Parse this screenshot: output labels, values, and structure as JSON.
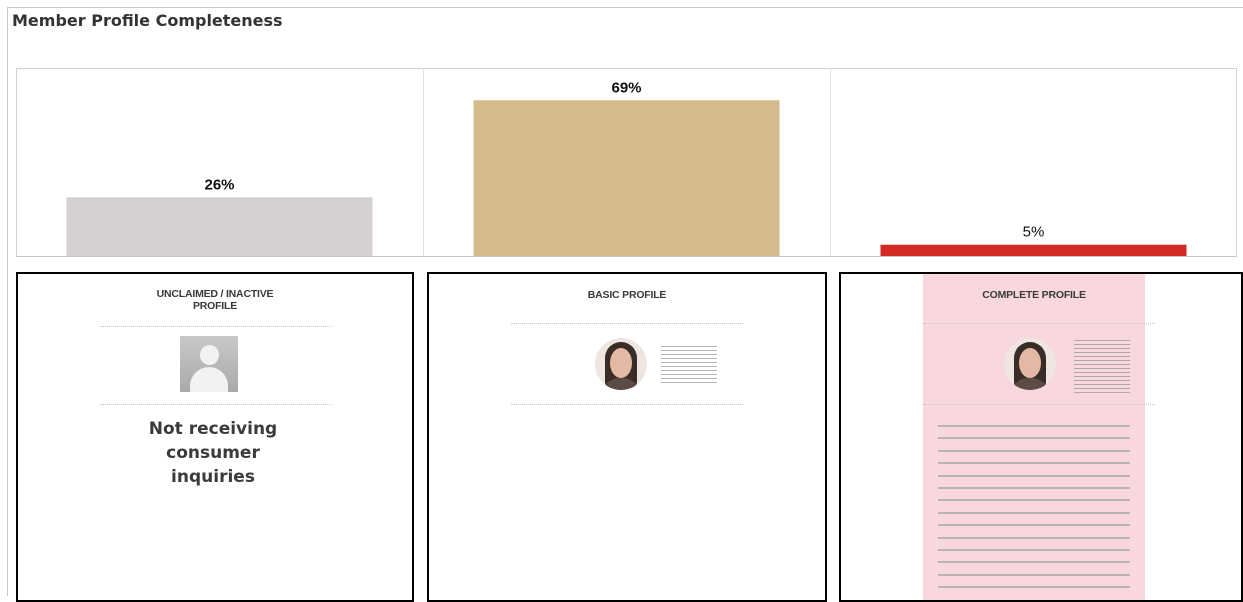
{
  "page": {
    "title": "Member Profile Completeness"
  },
  "chart_data": {
    "type": "bar",
    "categories": [
      "UNCLAIMED / INACTIVE PROFILE",
      "BASIC PROFILE",
      "COMPLETE PROFILE"
    ],
    "values": [
      26,
      69,
      5
    ],
    "value_labels": [
      "26%",
      "69%",
      "5%"
    ],
    "colors": [
      "#d4d1d0",
      "#d3bb8c",
      "#d42a26"
    ],
    "ylim": [
      0,
      70
    ],
    "legend": "none",
    "grid": false
  },
  "cards": [
    {
      "title": "UNCLAIMED / INACTIVE\nPROFILE",
      "note": "Not receiving\nconsumer\ninquiries"
    },
    {
      "title": "BASIC PROFILE"
    },
    {
      "title": "COMPLETE PROFILE"
    }
  ],
  "colors": {
    "complete_highlight": "#f8d7df",
    "border": "#c9c9c9"
  }
}
